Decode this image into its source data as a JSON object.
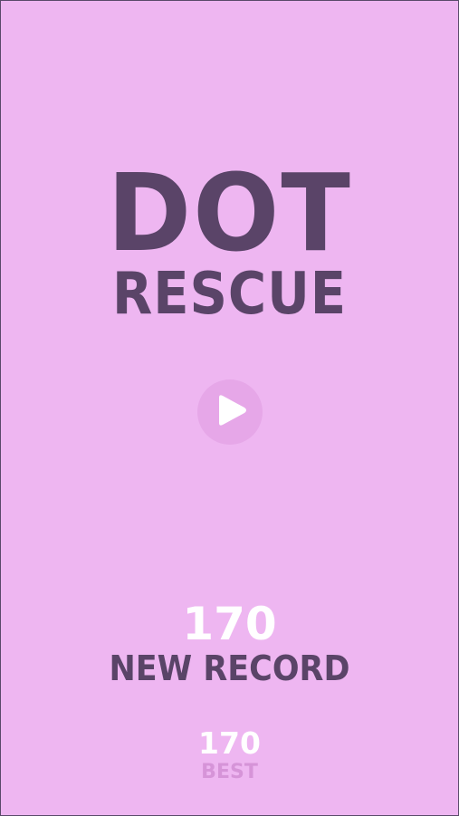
{
  "title": {
    "line1": "DOT",
    "line2": "RESCUE"
  },
  "play_button": {
    "icon": "play-icon"
  },
  "result": {
    "score": "170",
    "record_label": "NEW RECORD"
  },
  "best": {
    "value": "170",
    "label": "BEST"
  },
  "colors": {
    "background": "#eeb6f1",
    "title": "#5a4468",
    "play_circle": "#e6a7e8",
    "score": "#ffffff",
    "best_label": "#d694d8"
  }
}
